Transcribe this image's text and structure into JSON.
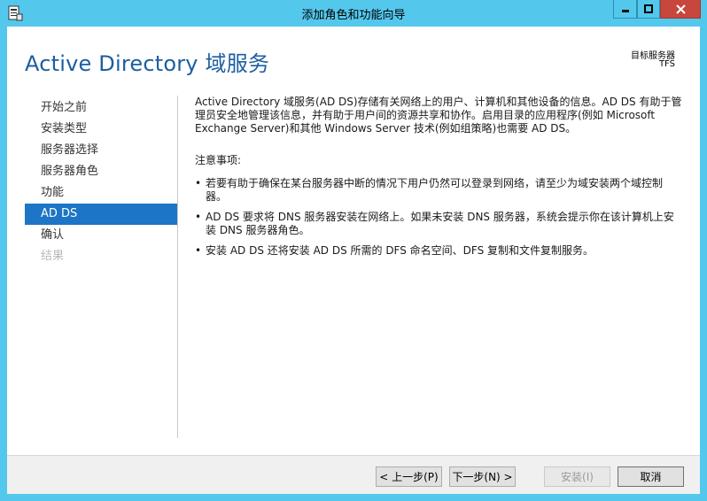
{
  "window": {
    "title": "添加角色和功能向导",
    "controls": {
      "minimize_icon": "minimize-icon",
      "maximize_icon": "maximize-icon",
      "close_icon": "close-icon"
    }
  },
  "header": {
    "title": "Active Directory 域服务",
    "target_label": "目标服务器",
    "target_value": "TFS"
  },
  "nav": {
    "items": [
      {
        "label": "开始之前",
        "state": "normal"
      },
      {
        "label": "安装类型",
        "state": "normal"
      },
      {
        "label": "服务器选择",
        "state": "normal"
      },
      {
        "label": "服务器角色",
        "state": "normal"
      },
      {
        "label": "功能",
        "state": "normal"
      },
      {
        "label": "AD DS",
        "state": "active"
      },
      {
        "label": "确认",
        "state": "normal"
      },
      {
        "label": "结果",
        "state": "disabled"
      }
    ]
  },
  "content": {
    "intro": "Active Directory 域服务(AD DS)存储有关网络上的用户、计算机和其他设备的信息。AD DS 有助于管理员安全地管理该信息，并有助于用户间的资源共享和协作。启用目录的应用程序(例如 Microsoft Exchange Server)和其他 Windows Server 技术(例如组策略)也需要 AD DS。",
    "notes_title": "注意事项:",
    "notes": [
      "若要有助于确保在某台服务器中断的情况下用户仍然可以登录到网络，请至少为域安装两个域控制器。",
      "AD DS 要求将 DNS 服务器安装在网络上。如果未安装 DNS 服务器，系统会提示你在该计算机上安装 DNS 服务器角色。",
      "安装 AD DS 还将安装 AD DS 所需的 DFS 命名空间、DFS 复制和文件复制服务。"
    ]
  },
  "footer": {
    "prev": "< 上一步(P)",
    "next": "下一步(N) >",
    "install": "安装(I)",
    "cancel": "取消"
  },
  "colors": {
    "frame": "#54c8ec",
    "accent": "#1c75c6",
    "title": "#1c5ea3",
    "close": "#c7463e"
  }
}
